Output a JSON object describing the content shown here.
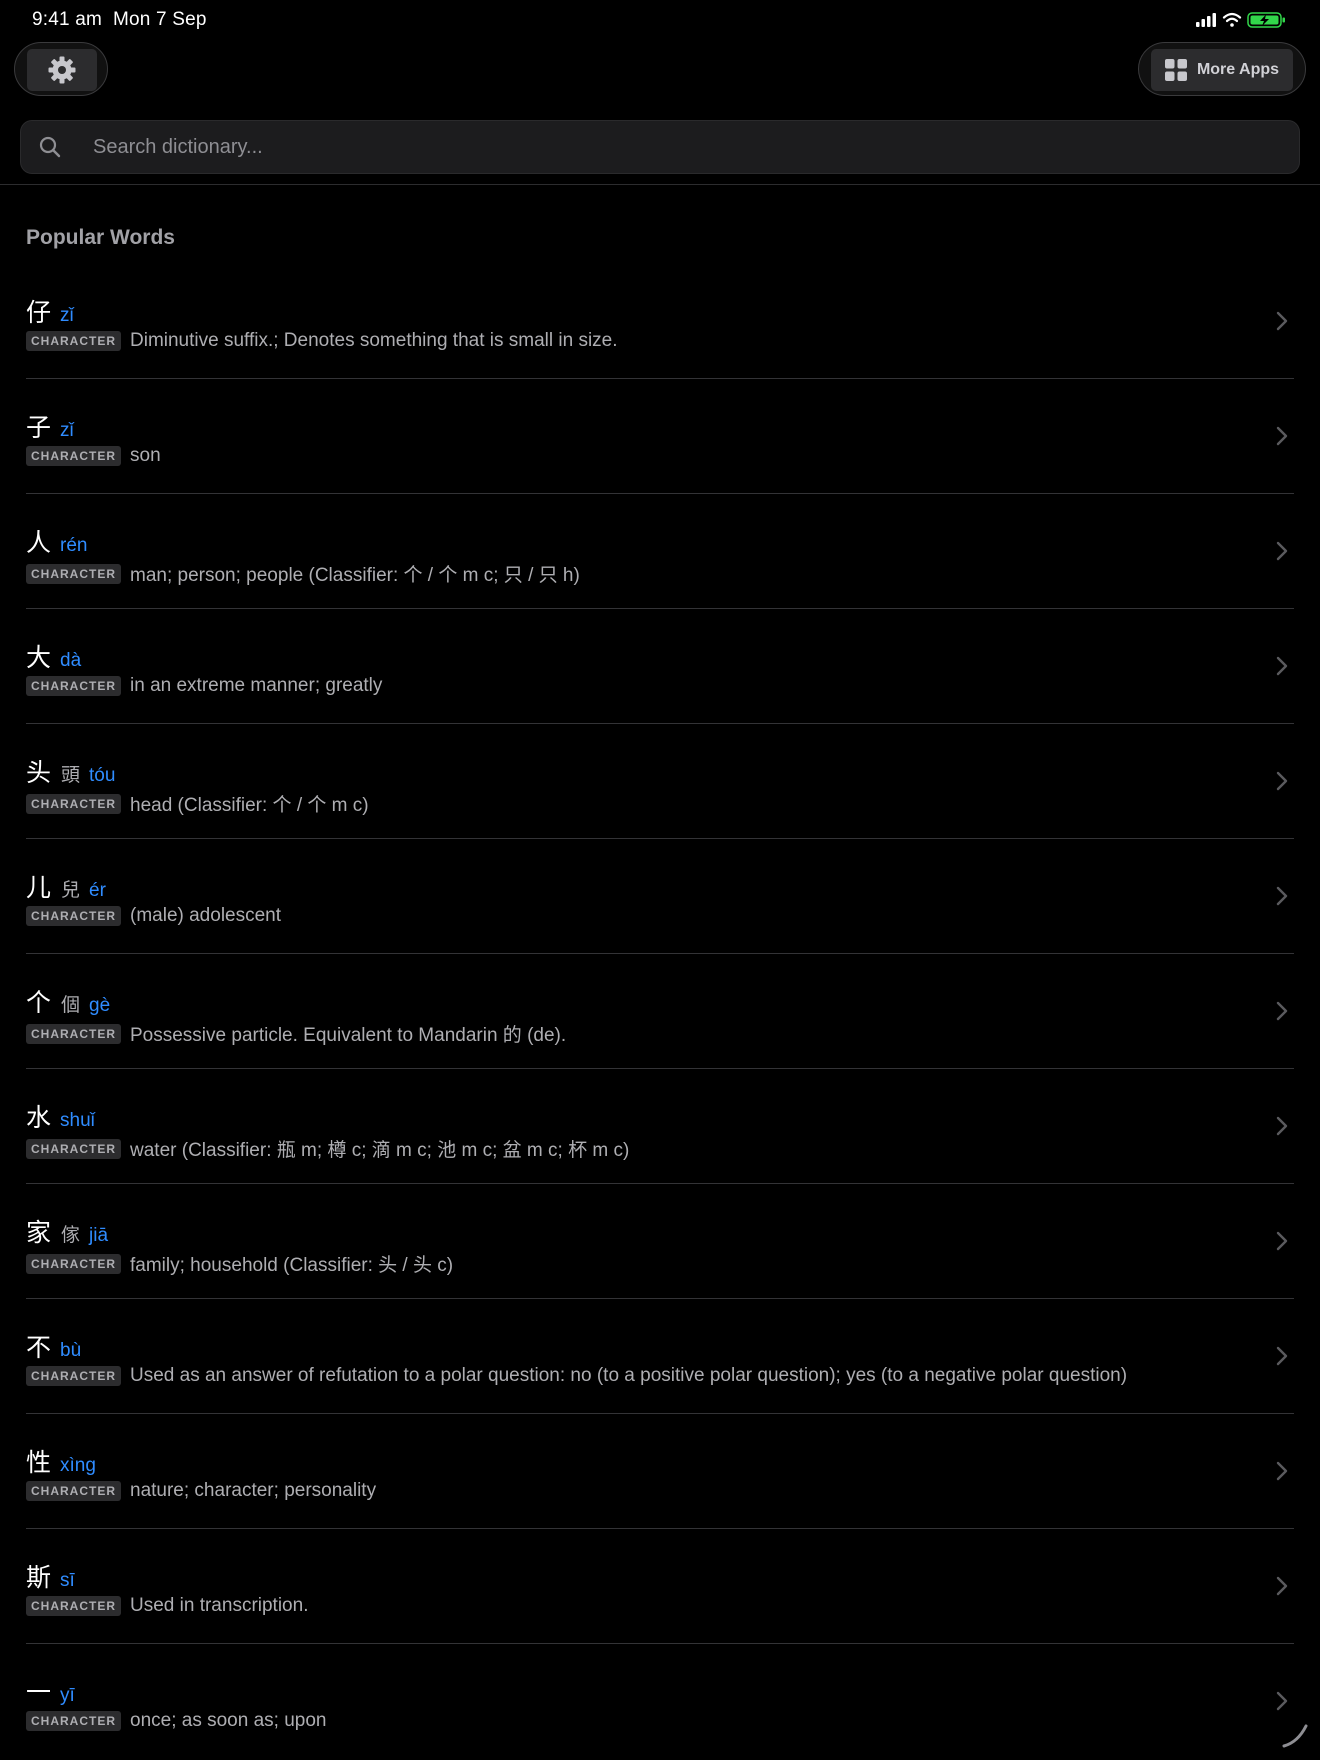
{
  "status_bar": {
    "time": "9:41 am  Mon 7 Sep",
    "battery_color": "#32d74b"
  },
  "toolbar": {
    "settings_icon": "gear-icon",
    "more_apps_icon": "grid-icon",
    "more_apps_label": "More Apps"
  },
  "search": {
    "placeholder": "Search dictionary...",
    "value": ""
  },
  "section": {
    "title": "Popular Words"
  },
  "colors": {
    "accent": "#2f8cff",
    "background": "#000000"
  },
  "words": [
    {
      "hanzi": "仔",
      "traditional": "",
      "pinyin": "zǐ",
      "badge": "CHARACTER",
      "definition": "Diminutive suffix.; Denotes something that is small in size."
    },
    {
      "hanzi": "子",
      "traditional": "",
      "pinyin": "zǐ",
      "badge": "CHARACTER",
      "definition": "son"
    },
    {
      "hanzi": "人",
      "traditional": "",
      "pinyin": "rén",
      "badge": "CHARACTER",
      "definition": "man; person; people (Classifier: 个 / 个 m c; 只 / 只 h)"
    },
    {
      "hanzi": "大",
      "traditional": "",
      "pinyin": "dà",
      "badge": "CHARACTER",
      "definition": "in an extreme manner; greatly"
    },
    {
      "hanzi": "头",
      "traditional": "頭",
      "pinyin": "tóu",
      "badge": "CHARACTER",
      "definition": "head (Classifier: 个 / 个 m c)"
    },
    {
      "hanzi": "儿",
      "traditional": "兒",
      "pinyin": "ér",
      "badge": "CHARACTER",
      "definition": "(male) adolescent"
    },
    {
      "hanzi": "个",
      "traditional": "個",
      "pinyin": "gè",
      "badge": "CHARACTER",
      "definition": "Possessive particle. Equivalent to Mandarin 的 (de)."
    },
    {
      "hanzi": "水",
      "traditional": "",
      "pinyin": "shuǐ",
      "badge": "CHARACTER",
      "definition": "water (Classifier: 瓶 m; 樽 c; 滴 m c; 池 m c; 盆 m c; 杯 m c)"
    },
    {
      "hanzi": "家",
      "traditional": "傢",
      "pinyin": "jiā",
      "badge": "CHARACTER",
      "definition": "family; household (Classifier: 头 / 头 c)"
    },
    {
      "hanzi": "不",
      "traditional": "",
      "pinyin": "bù",
      "badge": "CHARACTER",
      "definition": "Used as an answer of refutation to a polar question: no (to a positive polar question); yes (to a negative polar question)"
    },
    {
      "hanzi": "性",
      "traditional": "",
      "pinyin": "xìng",
      "badge": "CHARACTER",
      "definition": "nature; character; personality"
    },
    {
      "hanzi": "斯",
      "traditional": "",
      "pinyin": "sī",
      "badge": "CHARACTER",
      "definition": "Used in transcription."
    },
    {
      "hanzi": "一",
      "traditional": "",
      "pinyin": "yī",
      "badge": "CHARACTER",
      "definition": "once; as soon as; upon"
    }
  ]
}
